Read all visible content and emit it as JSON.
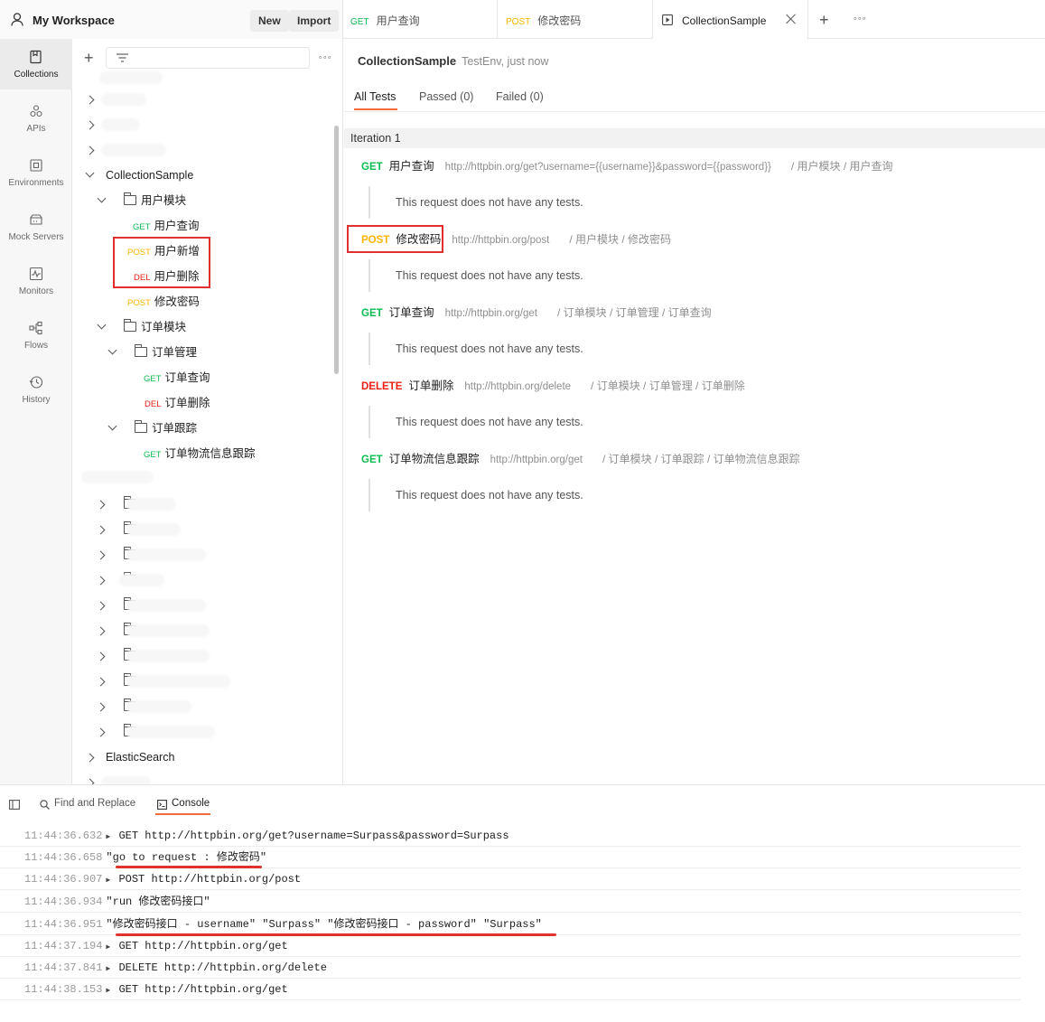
{
  "workspace": {
    "title": "My Workspace",
    "new_label": "New",
    "import_label": "Import"
  },
  "tabs": [
    {
      "method": "GET",
      "label": "用户查询"
    },
    {
      "method": "POST",
      "label": "修改密码"
    },
    {
      "label": "CollectionSample"
    }
  ],
  "rail": [
    {
      "label": "Collections",
      "icon": "collections-icon"
    },
    {
      "label": "APIs",
      "icon": "apis-icon"
    },
    {
      "label": "Environments",
      "icon": "environments-icon"
    },
    {
      "label": "Mock Servers",
      "icon": "mock-servers-icon"
    },
    {
      "label": "Monitors",
      "icon": "monitors-icon"
    },
    {
      "label": "Flows",
      "icon": "flows-icon"
    },
    {
      "label": "History",
      "icon": "history-icon"
    }
  ],
  "tree": {
    "collection": "CollectionSample",
    "folder_user": "用户模块",
    "user_items": [
      {
        "method": "GET",
        "label": "用户查询"
      },
      {
        "method": "POST",
        "label": "用户新增"
      },
      {
        "method": "DEL",
        "label": "用户删除"
      },
      {
        "method": "POST",
        "label": "修改密码"
      }
    ],
    "folder_order": "订单模块",
    "folder_order_mgmt": "订单管理",
    "order_mgmt_items": [
      {
        "method": "GET",
        "label": "订单查询"
      },
      {
        "method": "DEL",
        "label": "订单删除"
      }
    ],
    "folder_order_track": "订单跟踪",
    "order_track_items": [
      {
        "method": "GET",
        "label": "订单物流信息跟踪"
      }
    ],
    "elastic": "ElasticSearch"
  },
  "runner": {
    "title": "CollectionSample",
    "env": "TestEnv, just now",
    "tabs": [
      "All Tests",
      "Passed (0)",
      "Failed (0)"
    ],
    "iteration": "Iteration 1",
    "no_tests": "This request does not have any tests.",
    "requests": [
      {
        "method": "GET",
        "name": "用户查询",
        "url": "http://httpbin.org/get?username={{username}}&password={{password}}",
        "path": "/ 用户模块 / 用户查询"
      },
      {
        "method": "POST",
        "name": "修改密码",
        "url": "http://httpbin.org/post",
        "path": "/ 用户模块 / 修改密码"
      },
      {
        "method": "GET",
        "name": "订单查询",
        "url": "http://httpbin.org/get",
        "path": "/ 订单模块 / 订单管理 / 订单查询"
      },
      {
        "method": "DELETE",
        "name": "订单删除",
        "url": "http://httpbin.org/delete",
        "path": "/ 订单模块 / 订单管理 / 订单删除"
      },
      {
        "method": "GET",
        "name": "订单物流信息跟踪",
        "url": "http://httpbin.org/get",
        "path": "/ 订单模块 / 订单跟踪 / 订单物流信息跟踪"
      }
    ]
  },
  "console": {
    "tabs": [
      "Find and Replace",
      "Console"
    ],
    "logs": [
      {
        "ts": "11:44:36.632",
        "expand": true,
        "text": "GET http://httpbin.org/get?username=Surpass&password=Surpass"
      },
      {
        "ts": "11:44:36.658",
        "expand": false,
        "text": "\"go to request : 修改密码\""
      },
      {
        "ts": "11:44:36.907",
        "expand": true,
        "text": "POST http://httpbin.org/post"
      },
      {
        "ts": "11:44:36.934",
        "expand": false,
        "text": "\"run 修改密码接口\""
      },
      {
        "ts": "11:44:36.951",
        "expand": false,
        "text": "\"修改密码接口 - username\"  \"Surpass\"  \"修改密码接口 - password\"  \"Surpass\""
      },
      {
        "ts": "11:44:37.194",
        "expand": true,
        "text": "GET http://httpbin.org/get"
      },
      {
        "ts": "11:44:37.841",
        "expand": true,
        "text": "DELETE http://httpbin.org/delete"
      },
      {
        "ts": "11:44:38.153",
        "expand": true,
        "text": "GET http://httpbin.org/get"
      }
    ]
  },
  "colors": {
    "get": "#0cbb52",
    "post": "#ffb400",
    "delete": "#eb2013",
    "accent": "#f26b3a",
    "highlight": "#e0312f"
  }
}
